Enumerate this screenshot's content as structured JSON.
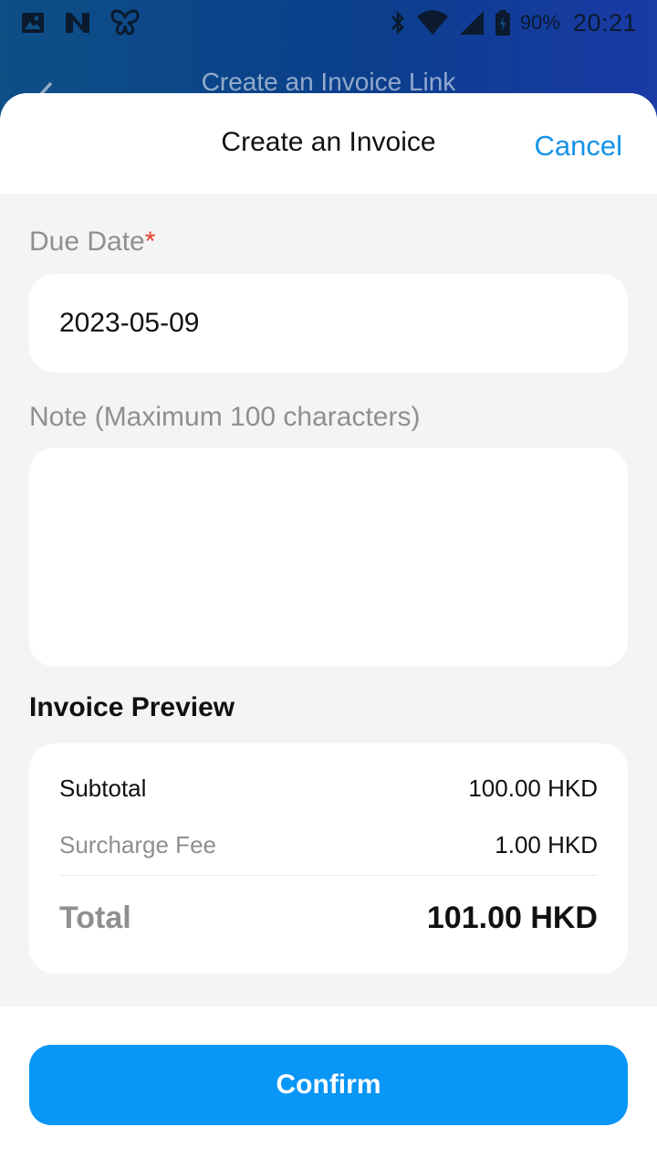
{
  "status_bar": {
    "battery_percent": "90%",
    "time": "20:21",
    "left_icons": [
      "image-icon",
      "n-app-icon",
      "butterfly-icon"
    ],
    "right_icons": [
      "bluetooth-icon",
      "wifi-icon",
      "cell-signal-icon",
      "battery-icon"
    ]
  },
  "background_page": {
    "title": "Create an Invoice Link"
  },
  "sheet": {
    "title": "Create an Invoice",
    "cancel_label": "Cancel"
  },
  "form": {
    "due_date": {
      "label": "Due Date",
      "required_mark": "*",
      "value": "2023-05-09"
    },
    "note": {
      "label": "Note (Maximum 100 characters)",
      "value": ""
    }
  },
  "preview": {
    "title": "Invoice Preview",
    "subtotal_label": "Subtotal",
    "subtotal_value": "100.00 HKD",
    "surcharge_label": "Surcharge Fee",
    "surcharge_value": "1.00 HKD",
    "total_label": "Total",
    "total_value": "101.00 HKD"
  },
  "footer": {
    "confirm_label": "Confirm"
  },
  "colors": {
    "accent": "#0896f7",
    "link": "#1593e8",
    "required": "#e53e2e",
    "header_gradient_start": "#0e4f86",
    "header_gradient_end": "#1a3aa6"
  }
}
